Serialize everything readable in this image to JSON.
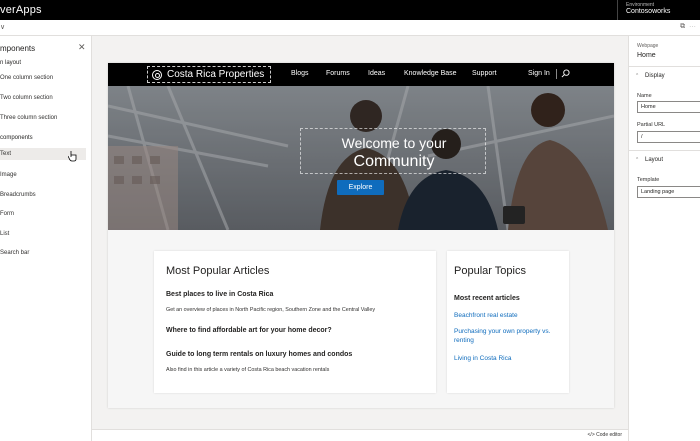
{
  "app": {
    "brand": "verApps",
    "environment_label": "Environment",
    "environment_name": "Contosoworks"
  },
  "subbar": {
    "title": ""
  },
  "left_panel": {
    "header": "mponents",
    "section_layout": "n layout",
    "layout_items": [
      "One column section",
      "Two column section",
      "Three column section"
    ],
    "section_components": "components",
    "component_items": [
      "Text",
      "Image",
      "Breadcrumbs",
      "Form",
      "List",
      "Search bar"
    ],
    "selected_item": "Text"
  },
  "site": {
    "logo_text": "Costa Rica Properties",
    "nav": [
      "Blogs",
      "Forums",
      "Ideas",
      "Knowledge Base",
      "Support"
    ],
    "sign_in": "Sign In",
    "hero": {
      "line1": "Welcome to your",
      "line2": "Community",
      "button": "Explore"
    },
    "articles": {
      "title": "Most Popular Articles",
      "items": [
        {
          "title": "Best places to live in Costa Rica",
          "desc": "Get an overview of places in North Pacific region, Southern Zone and the Central Valley"
        },
        {
          "title": "Where to find affordable art for your home decor?",
          "desc": ""
        },
        {
          "title": "Guide to long term rentals on luxury homes and condos",
          "desc": "Also find in this article  a variety of Costa Rica beach vacation rentals"
        }
      ]
    },
    "topics": {
      "title": "Popular Topics",
      "subtitle": "Most recent articles",
      "links": [
        "Beachfront real estate",
        "Purchasing your own property vs. renting",
        "Living in Costa Rica"
      ]
    }
  },
  "right_panel": {
    "type_label": "Webpage",
    "name": "Home",
    "section_display": "Display",
    "name_label": "Name",
    "name_value": "Home",
    "partial_url_label": "Partial URL",
    "partial_url_value": "/",
    "section_layout": "Layout",
    "template_label": "Template",
    "template_value": "Landing page"
  },
  "bottom": {
    "code_editor": "Code editor"
  },
  "colors": {
    "accent": "#0f6cbd",
    "topbar": "#000000"
  }
}
